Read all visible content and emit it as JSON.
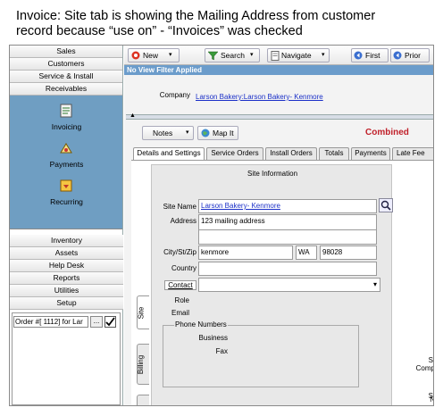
{
  "caption": {
    "line1": "Invoice: Site tab is showing the Mailing Address from customer",
    "line2": "record because “use on” - “Invoices” was checked"
  },
  "nav": {
    "top_buttons": [
      "Sales",
      "Customers",
      "Service & Install",
      "Receivables"
    ],
    "panel_items": [
      {
        "label": "Invoicing",
        "icon": "invoice-icon"
      },
      {
        "label": "Payments",
        "icon": "payments-icon"
      },
      {
        "label": "Recurring",
        "icon": "recurring-icon"
      }
    ],
    "bottom_buttons": [
      "Inventory",
      "Assets",
      "Help Desk",
      "Reports",
      "Utilities",
      "Setup"
    ],
    "order_field": "Order #[ 1112] for Lar",
    "order_more": "..."
  },
  "toolbar": {
    "new_label": "New",
    "search_label": "Search",
    "navigate_label": "Navigate",
    "first_label": "First",
    "prior_label": "Prior"
  },
  "filter_bar": "No View Filter Applied",
  "company": {
    "label": "Company",
    "value": "Larson Bakery:Larson Bakery- Kenmore"
  },
  "actions": {
    "notes_label": "Notes",
    "map_label": "Map It",
    "combined_label": "Combined"
  },
  "tabs": [
    "Details and Settings",
    "Service Orders",
    "Install Orders",
    "Totals",
    "Payments",
    "Late Fee"
  ],
  "site": {
    "section_title": "Site Information",
    "site_name_label": "Site Name",
    "site_name_value": "Larson Bakery- Kenmore",
    "address_label": "Address",
    "address_value": "123 mailing address",
    "city_label": "City/St/Zip",
    "city_value": "kenmore",
    "state_value": "WA",
    "zip_value": "98028",
    "country_label": "Country",
    "contact_label": "Contact",
    "role_label": "Role",
    "email_label": "Email",
    "phone_numbers_label": "Phone Numbers",
    "business_label": "Business",
    "fax_label": "Fax"
  },
  "vertical_tabs": [
    "Site",
    "Billing"
  ],
  "right_edge_labels": [
    "S",
    "S",
    "Comp",
    "I",
    "N"
  ],
  "colors": {
    "accent_blue": "#6f9ec2",
    "filter_bar": "#6b9ccb",
    "combined_red": "#c0202a",
    "link_blue": "#1b30c8"
  }
}
